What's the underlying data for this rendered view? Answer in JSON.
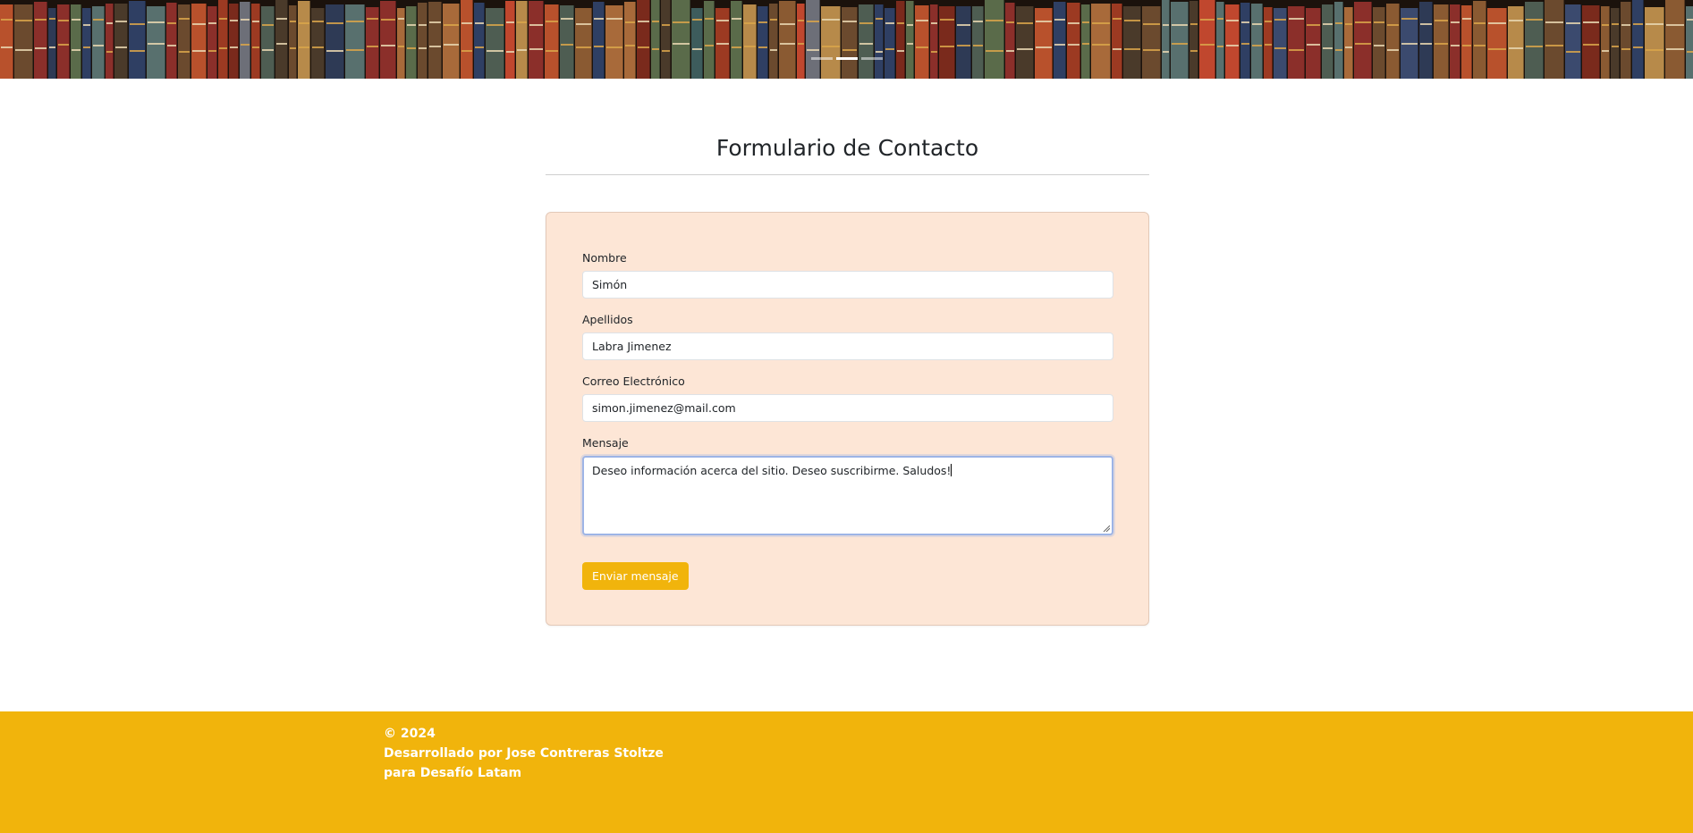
{
  "hero": {
    "indicators": [
      {
        "label": "Slide 1",
        "active": false
      },
      {
        "label": "Slide 2",
        "active": true
      },
      {
        "label": "Slide 3",
        "active": false
      }
    ]
  },
  "page": {
    "title": "Formulario de Contacto"
  },
  "form": {
    "nombre": {
      "label": "Nombre",
      "value": "Simón"
    },
    "apellidos": {
      "label": "Apellidos",
      "value": "Labra Jimenez"
    },
    "correo": {
      "label": "Correo Electrónico",
      "value": "simon.jimenez@mail.com"
    },
    "mensaje": {
      "label": "Mensaje",
      "value": "Deseo información acerca del sitio. Deseo suscribirme. Saludos!"
    },
    "submit_label": "Enviar mensaje",
    "card_color": "#fde6d6",
    "focus_border_color": "#9db4e6"
  },
  "footer": {
    "line1": "© 2024",
    "line2": "Desarrollado por Jose Contreras Stoltze",
    "line3": "para Desafío Latam",
    "background": "#f1b40c"
  }
}
